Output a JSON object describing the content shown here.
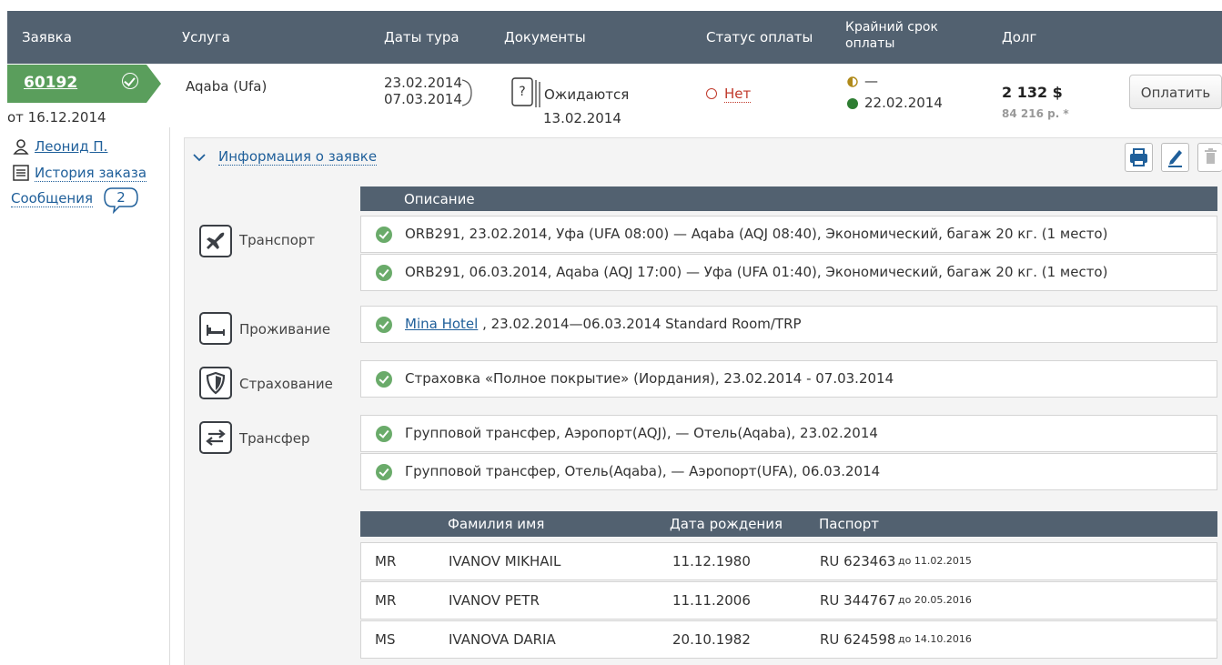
{
  "header": {
    "col_order": "Заявка",
    "col_service": "Услуга",
    "col_dates": "Даты тура",
    "col_docs": "Документы",
    "col_payment_status": "Статус оплаты",
    "col_deadline_1": "Крайний срок",
    "col_deadline_2": "оплаты",
    "col_debt": "Долг"
  },
  "order": {
    "number": "60192",
    "date": "от 16.12.2014",
    "manager": "Леонид П.",
    "history": "История заказа",
    "messages_label": "Сообщения",
    "messages_count": "2",
    "service": "Aqaba (Ufa)",
    "date_from": "23.02.2014",
    "date_to": "07.03.2014",
    "docs_icon": "?",
    "docs_status": "Ожидаются",
    "docs_date": "13.02.2014",
    "payment_status": "Нет",
    "deadline_first": "—",
    "deadline_second": "22.02.2014",
    "debt_main": "2 132 $",
    "debt_rub": "84 216 р. *",
    "pay_button": "Оплатить"
  },
  "info": {
    "toggle_label": "Информация о заявке",
    "description_header": "Описание",
    "categories": {
      "transport": "Транспорт",
      "accommodation": "Проживание",
      "insurance": "Страхование",
      "transfer": "Трансфер"
    },
    "transport": [
      "ORB291, 23.02.2014, Уфа (UFA 08:00) — Aqaba (AQJ 08:40), Экономический, багаж 20 кг. (1 место)",
      "ORB291, 06.03.2014, Aqaba (AQJ 17:00) — Уфа (UFA 01:40), Экономический, багаж 20 кг. (1 место)"
    ],
    "hotel_name": "Mina Hotel",
    "hotel_rest": " , 23.02.2014—06.03.2014 Standard Room/TRP",
    "insurance": "Страховка «Полное покрытие» (Иордания), 23.02.2014 - 07.03.2014",
    "transfer": [
      "Групповой трансфер, Аэропорт(AQJ), — Отель(Aqaba), 23.02.2014",
      "Групповой трансфер, Отель(Aqaba), — Аэропорт(UFA), 06.03.2014"
    ]
  },
  "tourists": {
    "col_name": "Фамилия имя",
    "col_birth": "Дата рождения",
    "col_passport": "Паспорт",
    "rows": [
      {
        "title": "MR",
        "name": "IVANOV MIKHAIL",
        "birth": "11.12.1980",
        "passport": "RU 623463",
        "valid": "до 11.02.2015"
      },
      {
        "title": "MR",
        "name": "IVANOV PETR",
        "birth": "11.11.2006",
        "passport": "RU 344767",
        "valid": "до 20.05.2016"
      },
      {
        "title": "MS",
        "name": "IVANOVA DARIA",
        "birth": "20.10.1982",
        "passport": "RU 624598",
        "valid": "до 14.10.2016"
      }
    ]
  },
  "colors": {
    "header_bg": "#526170",
    "order_green": "#5a9e5c",
    "link_blue": "#1f5f9a",
    "status_red": "#c0392b",
    "ok_green": "#6aab6a"
  },
  "icons": [
    "check-circle-icon",
    "user-icon",
    "list-icon",
    "speech-bubble-icon",
    "question-doc-icon",
    "chevron-down-icon",
    "printer-icon",
    "pencil-icon",
    "trash-icon",
    "airplane-icon",
    "bed-icon",
    "shield-icon",
    "transfer-arrows-icon"
  ]
}
